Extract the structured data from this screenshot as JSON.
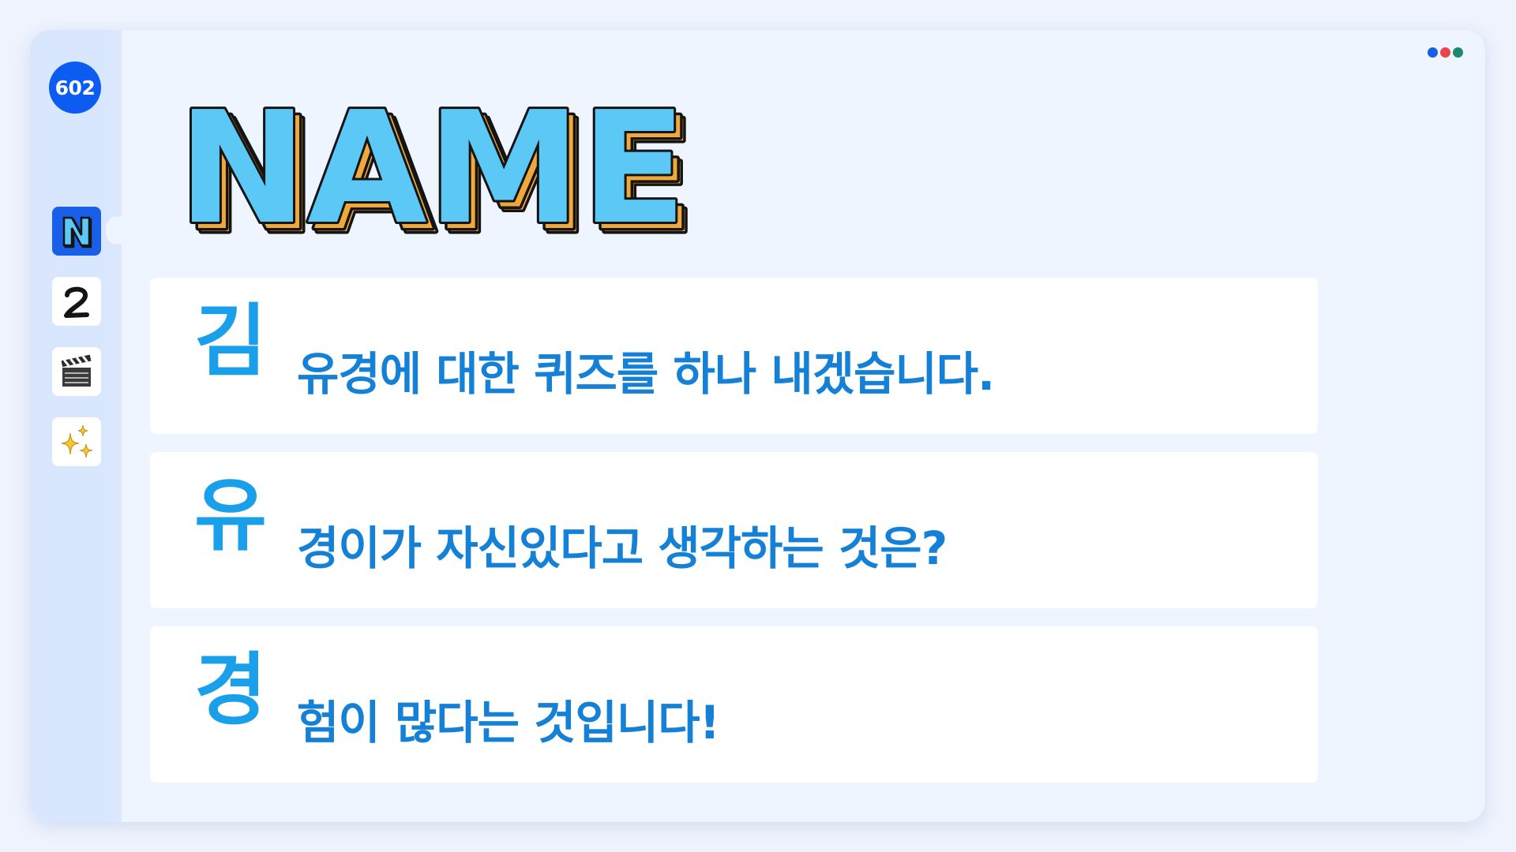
{
  "sidebar": {
    "slide_number": "602",
    "items": [
      {
        "name": "title-n-thumbnail",
        "icon": "letter-n-icon",
        "active": true
      },
      {
        "name": "number-two-thumbnail",
        "icon": "number-two-icon",
        "active": false
      },
      {
        "name": "clapperboard-thumbnail",
        "icon": "clapperboard-icon",
        "active": false
      },
      {
        "name": "sparkles-thumbnail",
        "icon": "sparkles-icon",
        "active": false
      }
    ]
  },
  "window_dots": [
    "#1a5fe8",
    "#e8464a",
    "#1b8a6b"
  ],
  "title": "NAME",
  "title_colors": {
    "fill": "#5bc8f5",
    "side": "#f0a83c",
    "outline": "#141414"
  },
  "cards": [
    {
      "initial": "김",
      "text": "유경에 대한 퀴즈를 하나 내겠습니다."
    },
    {
      "initial": "유",
      "text": "경이가 자신있다고 생각하는 것은?"
    },
    {
      "initial": "경",
      "text": "험이 많다는 것입니다!"
    }
  ],
  "colors": {
    "accent": "#1aa0ea",
    "text": "#1581d6",
    "badge": "#0d5cf2",
    "sidebar": "#d8e6fe",
    "background": "#eff5ff"
  }
}
